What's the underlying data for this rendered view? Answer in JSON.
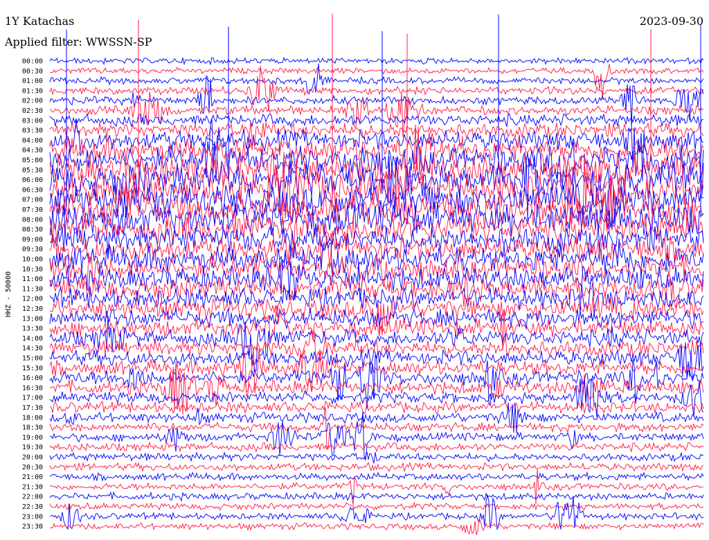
{
  "chart_data": {
    "type": "line",
    "title": "1Y Katachas",
    "date": "2023-09-30",
    "subtitle": "Applied filter: WWSSN-SP",
    "ylabel": "HHZ - 50000",
    "row_labels": [
      "00:00",
      "00:30",
      "01:00",
      "01:30",
      "02:00",
      "02:30",
      "03:00",
      "03:30",
      "04:00",
      "04:30",
      "05:00",
      "05:30",
      "06:00",
      "06:30",
      "07:00",
      "07:30",
      "08:00",
      "08:30",
      "09:00",
      "09:30",
      "10:00",
      "10:30",
      "11:00",
      "11:30",
      "12:00",
      "12:30",
      "13:00",
      "13:30",
      "14:00",
      "14:30",
      "15:00",
      "15:30",
      "16:00",
      "16:30",
      "17:00",
      "17:30",
      "18:00",
      "18:30",
      "19:00",
      "19:30",
      "20:00",
      "20:30",
      "21:00",
      "21:30",
      "22:00",
      "22:30",
      "23:00",
      "23:30"
    ],
    "row_activity": [
      0.05,
      0.05,
      0.06,
      0.08,
      0.09,
      0.1,
      0.15,
      0.2,
      0.28,
      0.35,
      0.42,
      0.48,
      0.5,
      0.5,
      0.5,
      0.5,
      0.48,
      0.45,
      0.4,
      0.38,
      0.38,
      0.36,
      0.35,
      0.34,
      0.3,
      0.3,
      0.26,
      0.24,
      0.22,
      0.22,
      0.22,
      0.2,
      0.2,
      0.18,
      0.14,
      0.14,
      0.12,
      0.1,
      0.09,
      0.09,
      0.08,
      0.08,
      0.07,
      0.07,
      0.07,
      0.06,
      0.06,
      0.06
    ],
    "series_colors": [
      "#0000ff",
      "#ff1a46"
    ]
  }
}
